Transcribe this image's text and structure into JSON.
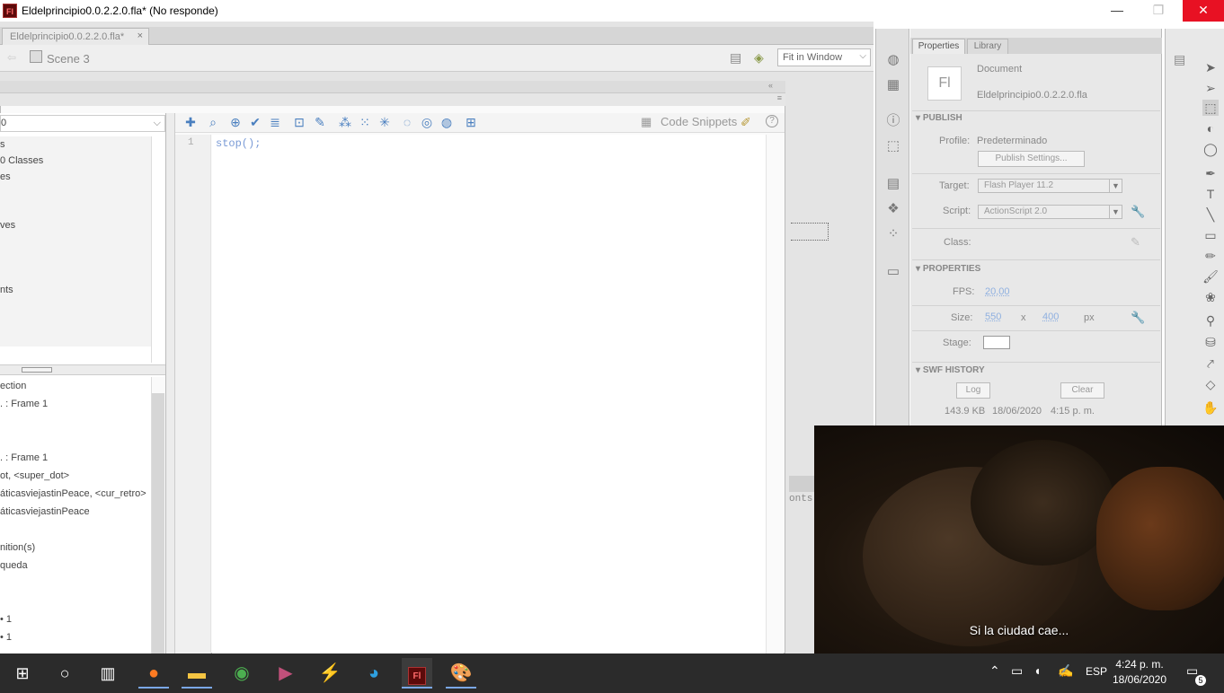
{
  "window": {
    "app_logo": "Fl",
    "title": "Eldelprincipio0.0.2.2.0.fla* (No responde)",
    "minimize": "—",
    "maximize": "❐",
    "close": "✕"
  },
  "document": {
    "tab_label": "Eldelprincipio0.0.2.2.0.fla*",
    "tab_close": "×",
    "scene": "Scene 3",
    "zoom": "Fit in Window"
  },
  "actions": {
    "target_value": "0",
    "toolbox_items": [
      "s",
      "0 Classes",
      "es",
      "ves",
      "nts"
    ],
    "script_nav_items": [
      "ection",
      ". : Frame 1",
      ". : Frame 1",
      "ot, <super_dot>",
      "áticasviejastinPeace, <cur_retro>",
      "áticasviejastinPeace",
      "nition(s)",
      "queda",
      "• 1",
      "• 1"
    ],
    "code_snippets": "Code Snippets",
    "help": "?",
    "line_number": "1",
    "code": "stop();",
    "output_fragment": "onts"
  },
  "properties": {
    "tab_properties": "Properties",
    "tab_library": "Library",
    "doc_icon": "Fl",
    "doc_type": "Document",
    "doc_name": "Eldelprincipio0.0.2.2.0.fla",
    "publish_header": "PUBLISH",
    "profile_label": "Profile:",
    "profile_value": "Predeterminado",
    "publish_settings": "Publish Settings...",
    "target_label": "Target:",
    "target_value": "Flash Player 11.2",
    "script_label": "Script:",
    "script_value": "ActionScript 2.0",
    "class_label": "Class:",
    "properties_header": "PROPERTIES",
    "fps_label": "FPS:",
    "fps_value": "20,00",
    "size_label": "Size:",
    "width": "550",
    "x": "x",
    "height": "400",
    "px": "px",
    "stage_label": "Stage:",
    "swf_header": "SWF HISTORY",
    "log_button": "Log",
    "clear_button": "Clear",
    "swf_size": "143.9 KB",
    "swf_date": "18/06/2020",
    "swf_time": "4:15 p. m."
  },
  "video": {
    "subtitle": "Si la ciudad cae..."
  },
  "taskbar": {
    "language": "ESP",
    "time": "4:24 p. m.",
    "date": "18/06/2020",
    "notifications": "5"
  },
  "colors": {
    "close_button": "#e81123",
    "taskbar": "#2b2b2b",
    "code_text": "#7a9bd6"
  }
}
